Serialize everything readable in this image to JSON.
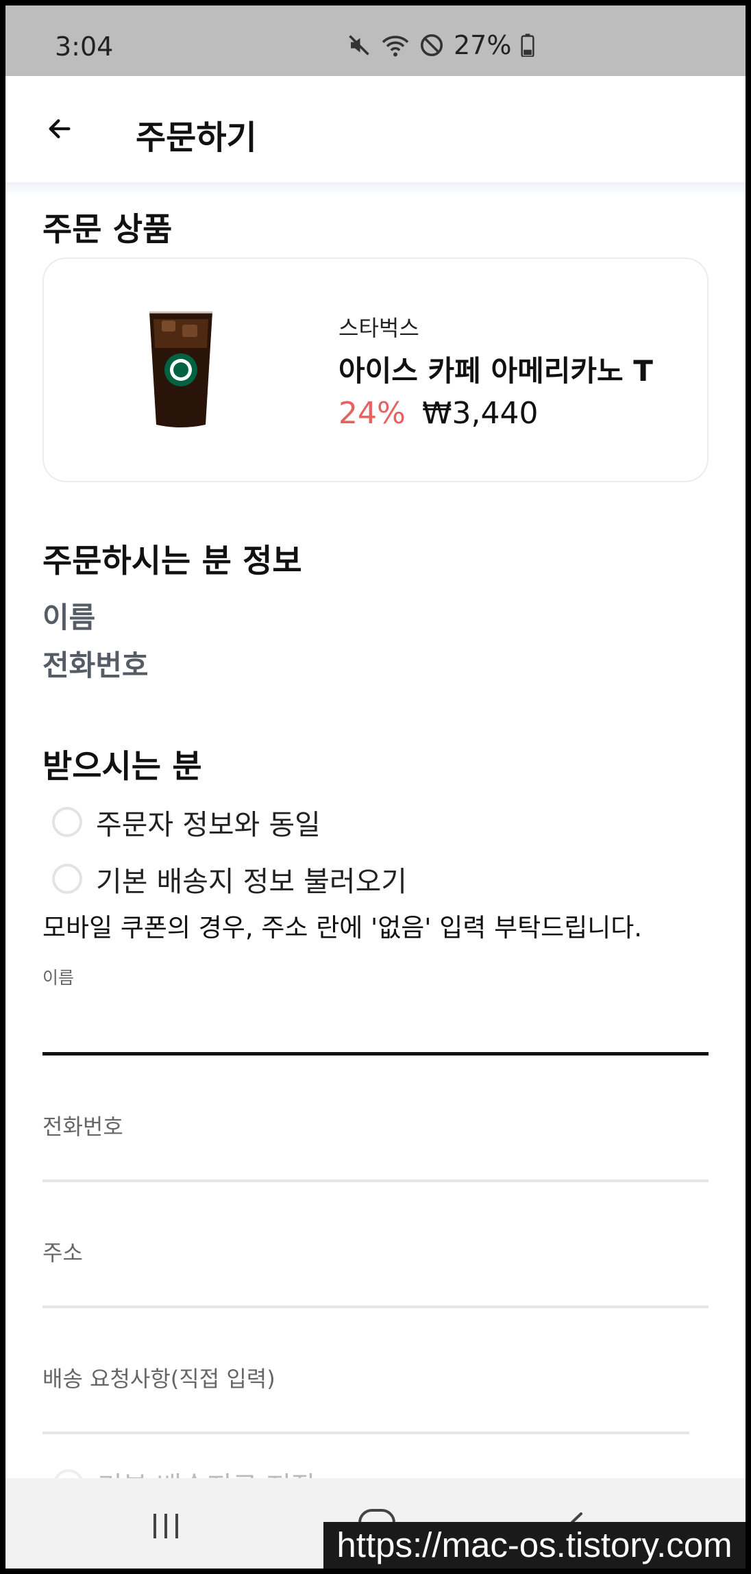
{
  "status_bar": {
    "time": "3:04",
    "battery": "27%"
  },
  "app_bar": {
    "title": "주문하기"
  },
  "order_items": {
    "title": "주문 상품",
    "product": {
      "brand": "스타벅스",
      "name": "아이스 카페 아메리카노 T",
      "discount": "24%",
      "price": "₩3,440"
    }
  },
  "orderer_info": {
    "title": "주문하시는 분 정보",
    "name_label": "이름",
    "phone_label": "전화번호"
  },
  "recipient": {
    "title": "받으시는 분",
    "options": [
      "주문자 정보와 동일",
      "기본 배송지 정보 불러오기"
    ],
    "notice": "모바일 쿠폰의 경우, 주소 란에 '없음' 입력 부탁드립니다.",
    "fields": {
      "name": {
        "label": "이름",
        "value": ""
      },
      "phone": {
        "label": "전화번호",
        "value": ""
      },
      "address": {
        "label": "주소",
        "value": ""
      },
      "request": {
        "label": "배송 요청사항(직접 입력)",
        "value": ""
      }
    },
    "partial_option": "기본 배송지로 저장"
  },
  "watermark": "https://mac-os.tistory.com",
  "colors": {
    "accent_red": "#e8605f",
    "status_bar_bg": "#bdbdbd",
    "text_primary": "#111111",
    "text_secondary": "#555c66"
  },
  "icons": {
    "back": "arrow-left-icon",
    "mute": "mute-icon",
    "wifi": "wifi-icon",
    "dnd": "do-not-disturb-icon",
    "battery": "battery-icon"
  }
}
